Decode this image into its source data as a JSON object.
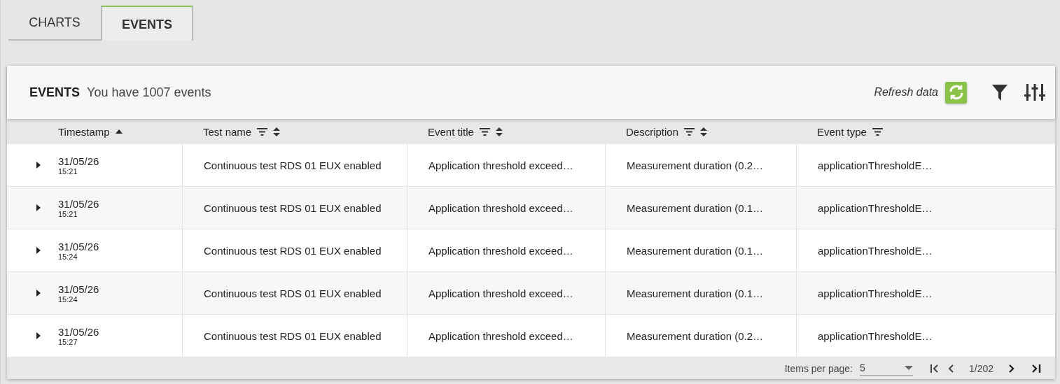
{
  "tabs": [
    {
      "label": "CHARTS",
      "selected": false
    },
    {
      "label": "EVENTS",
      "selected": true
    }
  ],
  "panel": {
    "title": "EVENTS",
    "summary": "You have 1007 events",
    "refresh_label": "Refresh data"
  },
  "table": {
    "columns": [
      {
        "label": "Timestamp",
        "filterable": false,
        "kind": "sorted"
      },
      {
        "label": "Test name",
        "filterable": true,
        "kind": "sortable"
      },
      {
        "label": "Event title",
        "filterable": true,
        "kind": "sortable"
      },
      {
        "label": "Description",
        "filterable": true,
        "kind": "sortable"
      },
      {
        "label": "Event type",
        "filterable": true,
        "kind": "plain"
      }
    ],
    "rows": [
      {
        "expanded": false,
        "date": "31/05/26",
        "time": "15:21",
        "test": "Continuous test RDS 01 EUX enabled",
        "title": "Application threshold exceed…",
        "description": "Measurement duration (0.2…",
        "type": "applicationThresholdE…"
      },
      {
        "expanded": false,
        "date": "31/05/26",
        "time": "15:21",
        "test": "Continuous test RDS 01 EUX enabled",
        "title": "Application threshold exceed…",
        "description": "Measurement duration (0.1…",
        "type": "applicationThresholdE…"
      },
      {
        "expanded": false,
        "date": "31/05/26",
        "time": "15:24",
        "test": "Continuous test RDS 01 EUX enabled",
        "title": "Application threshold exceed…",
        "description": "Measurement duration (0.1…",
        "type": "applicationThresholdE…"
      },
      {
        "expanded": false,
        "date": "31/05/26",
        "time": "15:24",
        "test": "Continuous test RDS 01 EUX enabled",
        "title": "Application threshold exceed…",
        "description": "Measurement duration (0.1…",
        "type": "applicationThresholdE…"
      },
      {
        "expanded": false,
        "date": "31/05/26",
        "time": "15:27",
        "test": "Continuous test RDS 01 EUX enabled",
        "title": "Application threshold exceed…",
        "description": "Measurement duration (0.2…",
        "type": "applicationThresholdE…"
      }
    ]
  },
  "pagination": {
    "items_per_page_label": "Items per page:",
    "items_per_page": "5",
    "page": "1/202"
  }
}
